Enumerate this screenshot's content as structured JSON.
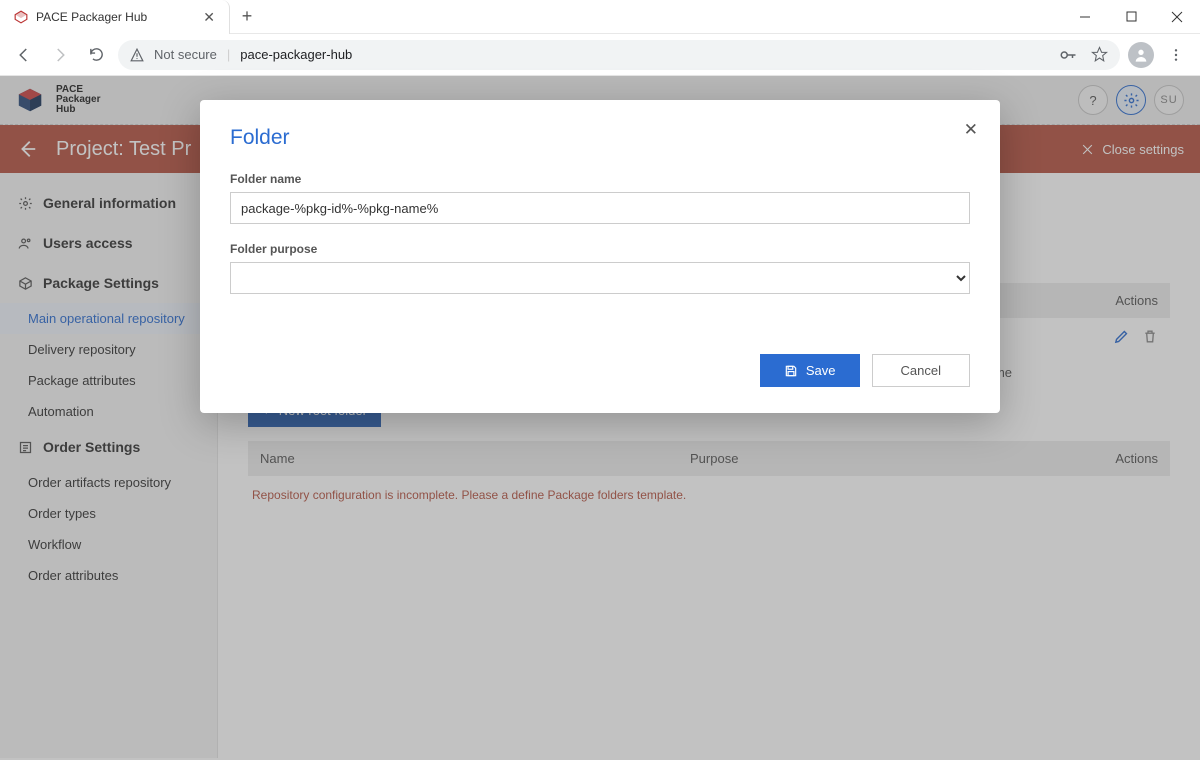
{
  "browser": {
    "tab_title": "PACE Packager Hub",
    "not_secure": "Not secure",
    "url": "pace-packager-hub"
  },
  "app": {
    "logo_line1": "PACE",
    "logo_line2": "Packager",
    "logo_line3": "Hub",
    "user_initials": "SU"
  },
  "project_bar": {
    "title": "Project: Test Pr",
    "close_label": "Close settings"
  },
  "sidebar": {
    "general": "General information",
    "users": "Users access",
    "pkg_settings": "Package Settings",
    "pkg_items": {
      "main_repo": "Main operational repository",
      "delivery": "Delivery repository",
      "attrs": "Package attributes",
      "automation": "Automation"
    },
    "order_settings": "Order Settings",
    "order_items": {
      "artifacts": "Order artifacts repository",
      "types": "Order types",
      "workflow": "Workflow",
      "attrs": "Order attributes"
    }
  },
  "content": {
    "table1": {
      "actions": "Actions"
    },
    "info_text": "Define what folders have to be created for every new package. The created package folder structure can be modified at any time",
    "new_root_btn": "New root folder",
    "table2": {
      "name": "Name",
      "purpose": "Purpose",
      "actions": "Actions"
    },
    "warning": "Repository configuration is incomplete. Please a define Package folders template."
  },
  "dialog": {
    "title": "Folder",
    "name_label": "Folder name",
    "name_value": "package-%pkg-id%-%pkg-name%",
    "purpose_label": "Folder purpose",
    "purpose_value": "",
    "save": "Save",
    "cancel": "Cancel"
  }
}
